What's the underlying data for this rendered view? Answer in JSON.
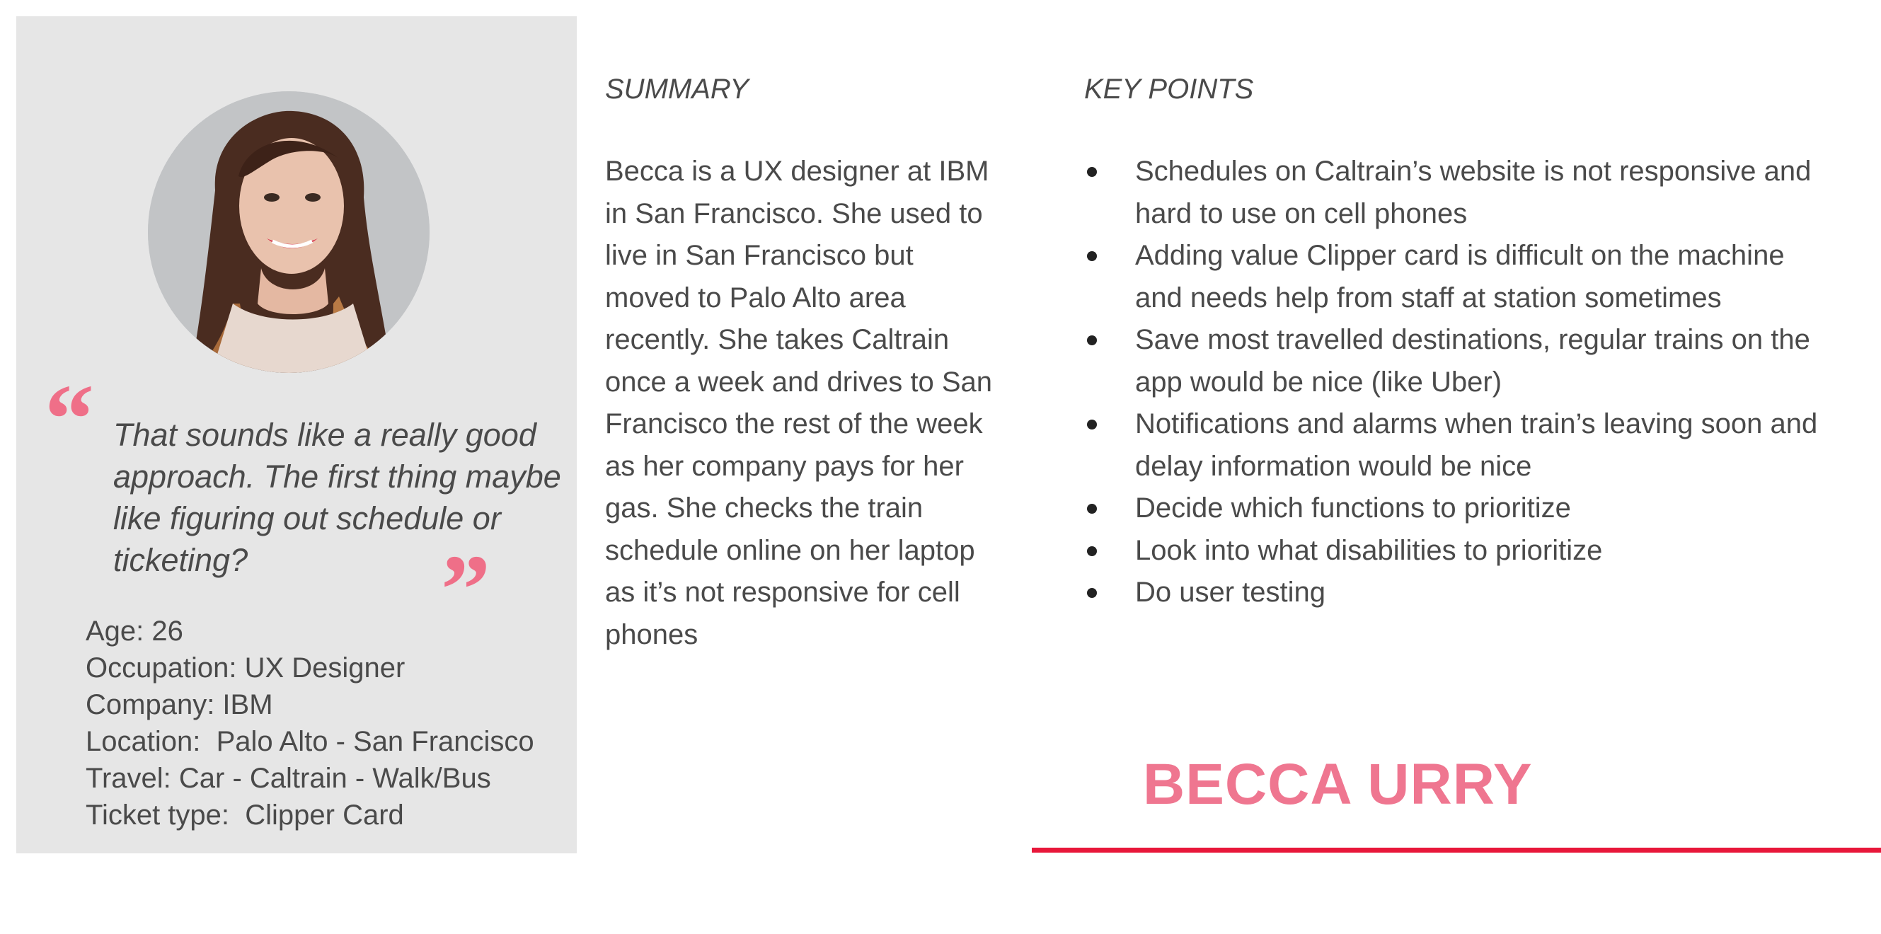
{
  "profile": {
    "name": "BECCA URRY",
    "quote": "That sounds like a really good approach. The first thing maybe like figuring out schedule or ticketing?",
    "quote_open_mark": "“",
    "quote_close_mark": "”",
    "details": [
      "Age: 26",
      "Occupation: UX Designer",
      "Company: IBM",
      "Location:  Palo Alto - San Francisco",
      "Travel: Car - Caltrain - Walk/Bus",
      "Ticket type:  Clipper Card"
    ]
  },
  "summary": {
    "heading": "SUMMARY",
    "text": "Becca is a UX designer at IBM in San Francisco. She used to live in San Francisco but moved to Palo Alto area recently. She takes Caltrain once a week and drives to San Francisco the rest of the week as her company pays for her gas. She checks the train schedule online on her laptop as it’s not responsive for cell phones"
  },
  "key_points": {
    "heading": "KEY POINTS",
    "items": [
      "Schedules on Caltrain’s website is not responsive and hard to use on cell phones",
      "Adding value Clipper card is difficult on the machine and needs help from staff at station sometimes",
      "Save most travelled destinations, regular trains on the app would be nice (like Uber)",
      "Notifications and alarms when train’s leaving soon and delay information would be nice",
      "Decide which functions to prioritize",
      "Look into what disabilities to prioritize",
      "Do user testing"
    ]
  },
  "colors": {
    "accent_pink": "#ef6f88",
    "underline_red": "#e8173a",
    "panel_gray": "#e6e6e6",
    "text_gray": "#4a4a4a"
  }
}
